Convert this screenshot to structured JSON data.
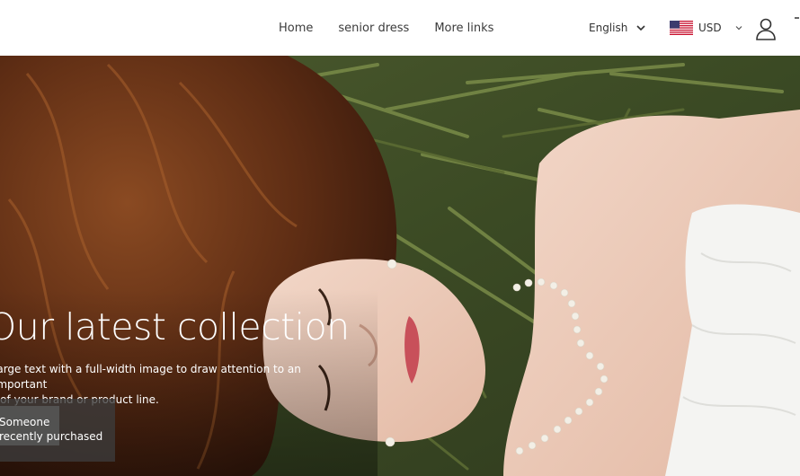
{
  "header": {
    "nav": [
      "Home",
      "senior dress",
      "More links"
    ],
    "language": "English",
    "currency": "USD",
    "icons": {
      "language_dropdown": "chevron-down-icon",
      "currency_dropdown": "chevron-down-icon",
      "flag": "us-flag-icon",
      "account": "user-icon"
    }
  },
  "hero": {
    "title": "Our latest collection",
    "subtitle_line1": "large text with a full-width image to draw attention to an important",
    "subtitle_line2": "l of your brand or product line."
  },
  "purchase_popup": {
    "line1": "Someone",
    "line2": "recently purchased"
  },
  "colors": {
    "header_bg": "#ffffff",
    "hero_text": "#ffffff",
    "popup_bg": "#3c3c3c"
  }
}
